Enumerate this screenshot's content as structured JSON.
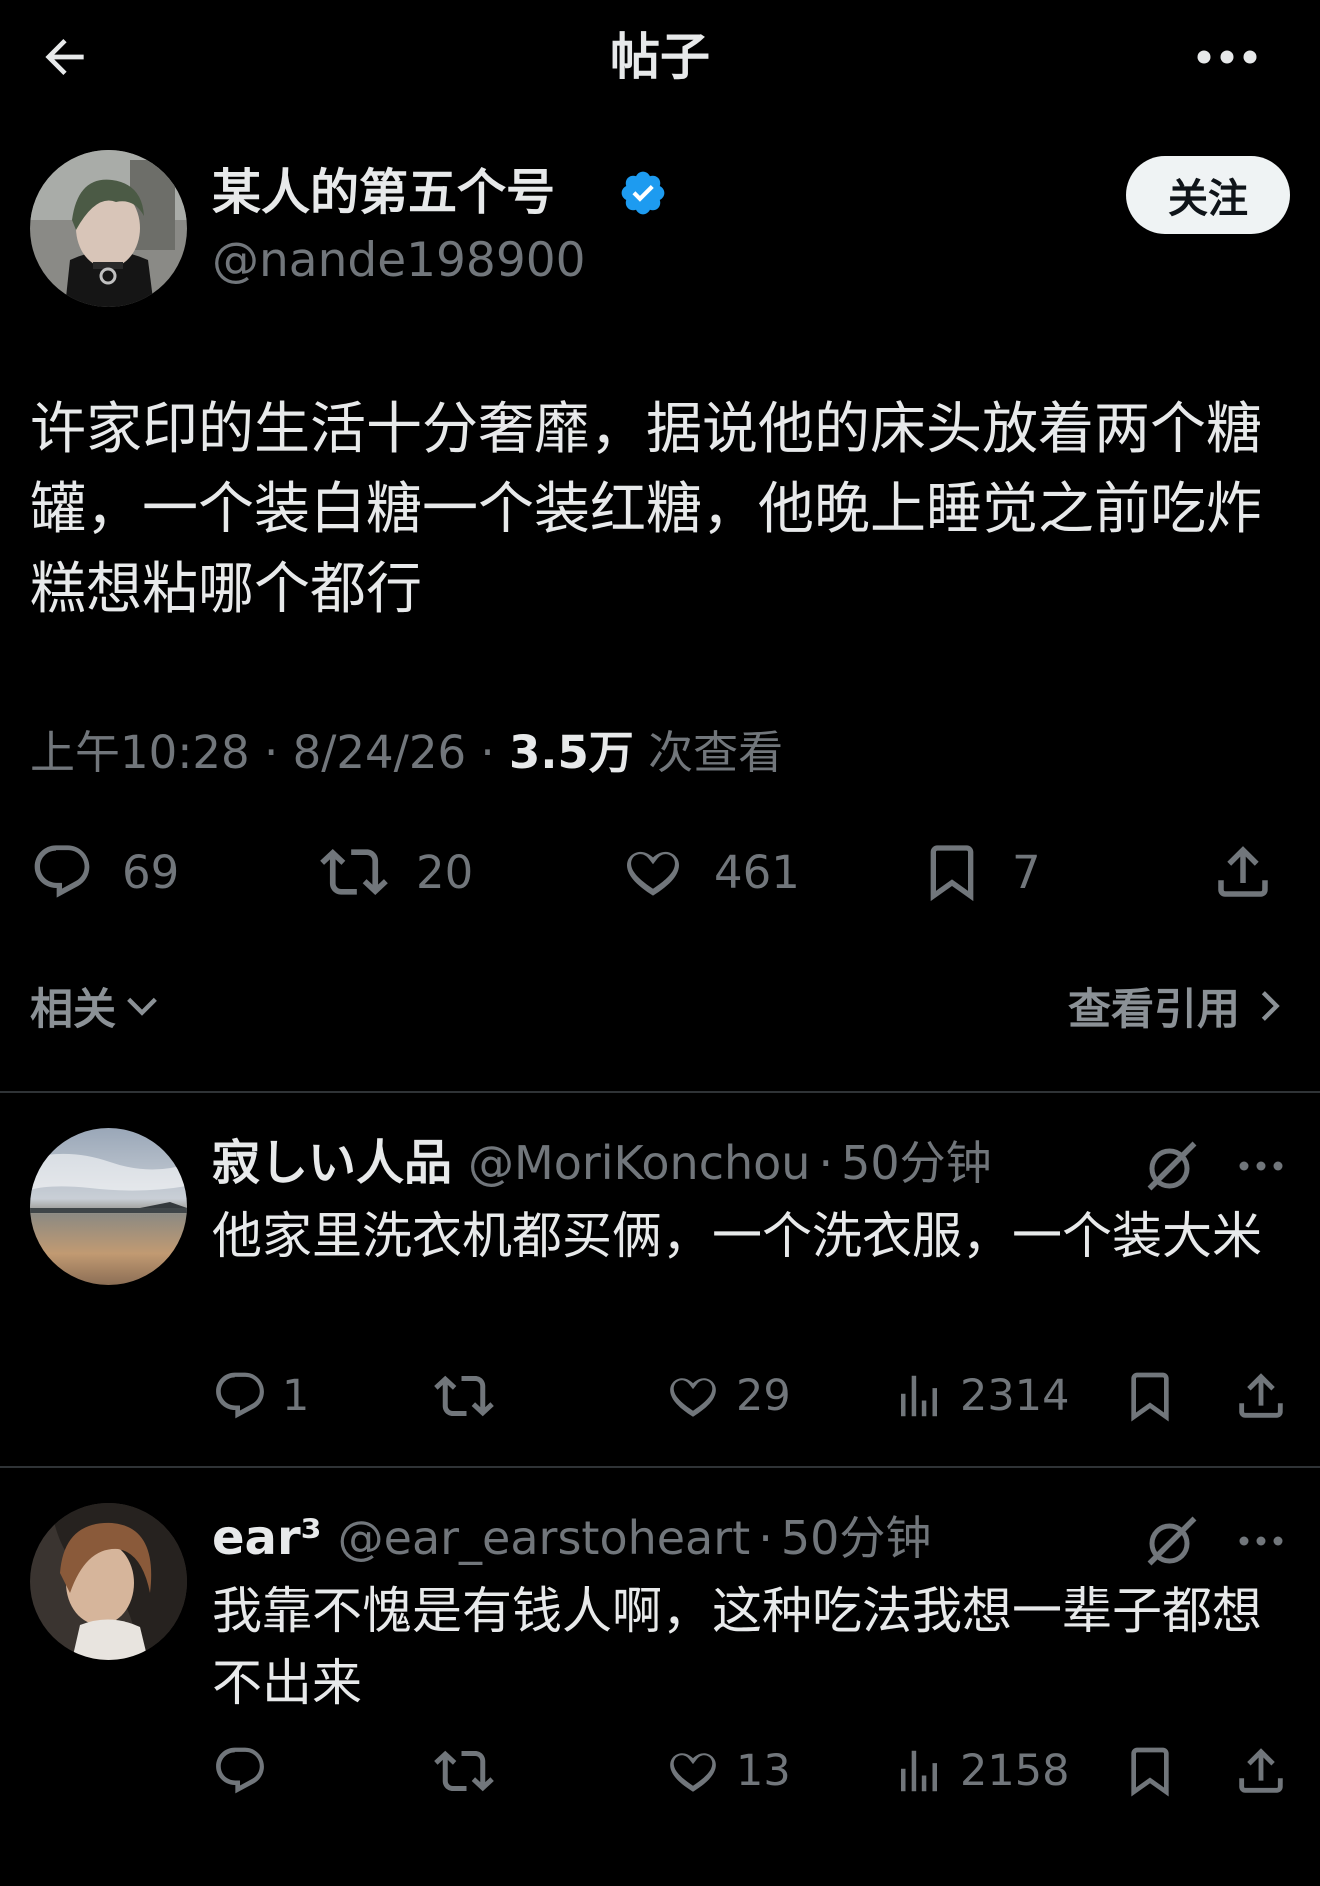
{
  "header": {
    "title": "帖子",
    "back_icon": "arrow-left-icon",
    "more_icon": "more-horizontal-icon"
  },
  "post": {
    "author": {
      "name": "某人的第五个号",
      "handle": "@nande198900",
      "verified": true
    },
    "follow_label": "关注",
    "text": "许家印的生活十分奢靡，据说他的床头放着两个糖罐，一个装白糖一个装红糖，他晚上睡觉之前吃炸糕想粘哪个都行",
    "meta": {
      "time": "上午10:28",
      "date": "8/24/26",
      "views": "3.5万",
      "views_suffix": "次查看",
      "separator": "·"
    },
    "actions": {
      "replies": "69",
      "reposts": "20",
      "likes": "461",
      "bookmarks": "7"
    }
  },
  "related_label": "相关",
  "view_quotes_label": "查看引用",
  "replies": [
    {
      "name": "寂しい人品",
      "handle": "@MoriKonchou",
      "time": "50分钟",
      "text": "他家里洗衣机都买俩，一个洗衣服，一个装大米",
      "replies": "1",
      "reposts": "",
      "likes": "29",
      "views": "2314"
    },
    {
      "name": "ear³",
      "handle": "@ear_earstoheart",
      "time": "50分钟",
      "text": "我靠不愧是有钱人啊，这种吃法我想一辈子都想不出来",
      "replies": "",
      "reposts": "",
      "likes": "13",
      "views": "2158"
    }
  ],
  "colors": {
    "background": "#000000",
    "text_primary": "#e7e9ea",
    "text_secondary": "#71767b",
    "verified": "#1d9bf0",
    "follow_bg": "#eff3f4",
    "divider": "#2f3336"
  }
}
